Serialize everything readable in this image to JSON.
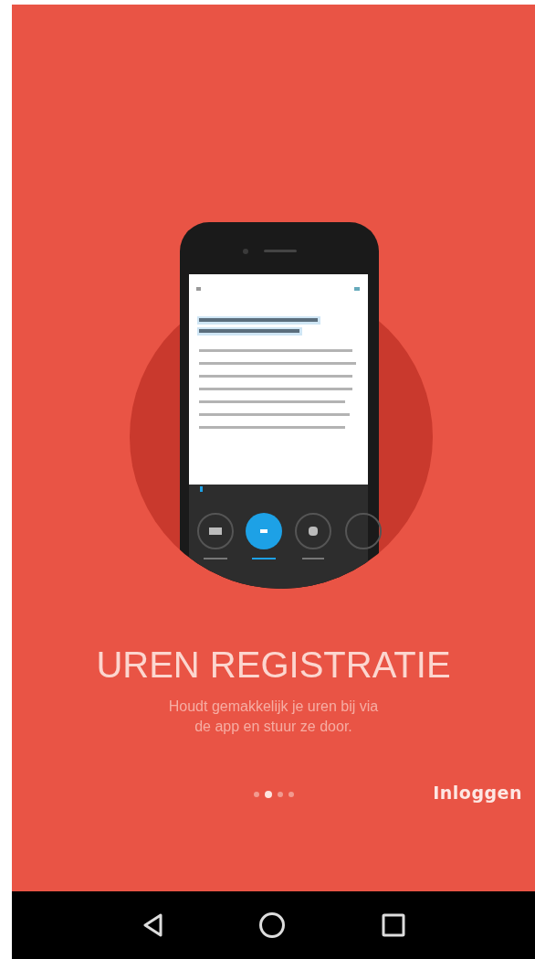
{
  "slide": {
    "title": "UREN REGISTRATIE",
    "description": "Houdt gemakkelijk je uren bij via de app en stuur ze door."
  },
  "pager": [
    {
      "selected": false
    },
    {
      "selected": true
    },
    {
      "selected": false
    },
    {
      "selected": false
    }
  ],
  "login_button": {
    "label": "Inloggen"
  }
}
